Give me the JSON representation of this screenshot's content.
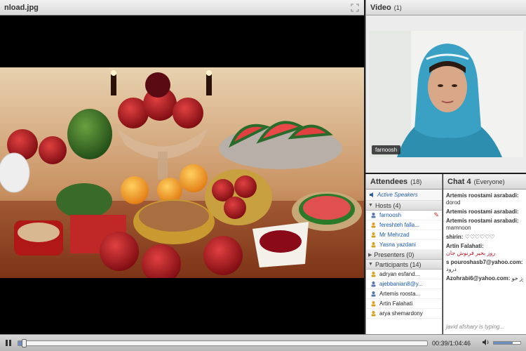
{
  "share_pod": {
    "title": "nload.jpg"
  },
  "video_pod": {
    "title": "Video",
    "count": "(1)",
    "cam_label": "farnoosh"
  },
  "attendees_pod": {
    "title": "Attendees",
    "count": "(18)",
    "active_speakers": "Active Speakers",
    "hosts_header": "Hosts (4)",
    "hosts": [
      "farnoosh",
      "fereshteh falla...",
      "Mr Mehrzad",
      "Yasna yazdani"
    ],
    "presenters_header": "Presenters (0)",
    "participants_header": "Participants (14)",
    "participants": [
      "adryan esfand...",
      "ajebbanian8@y...",
      "Artemis roosta...",
      "Artin Falahati",
      "arya shemardony"
    ]
  },
  "chat_pod": {
    "title": "Chat 4",
    "scope": "(Everyone)",
    "messages": [
      {
        "sender": "Artemis roostami asrabadi:",
        "text": "dorod"
      },
      {
        "sender": "Artemis roostami asrabadi:",
        "text": ""
      },
      {
        "sender": "Artemis roostami asrabadi:",
        "text": "mamnoon"
      },
      {
        "sender": "shirin:",
        "text": "♡♡♡♡♡♡"
      },
      {
        "sender": "Artin Falahati:",
        "text": "روز بخیر فرنوش جان"
      },
      {
        "sender": "s pouroshasb7@yahoo.com:",
        "text": "درود"
      },
      {
        "sender": "Azohrabi6@yahoo.com:",
        "text": "روز خو"
      }
    ],
    "typing": "javid afshary is typing..."
  },
  "playback": {
    "time": "00:39/1:04:46",
    "progress": 0.01,
    "volume": 0.7
  },
  "colors": {
    "accent": "#6d8fbf",
    "host_name": "#1a5bb8"
  }
}
